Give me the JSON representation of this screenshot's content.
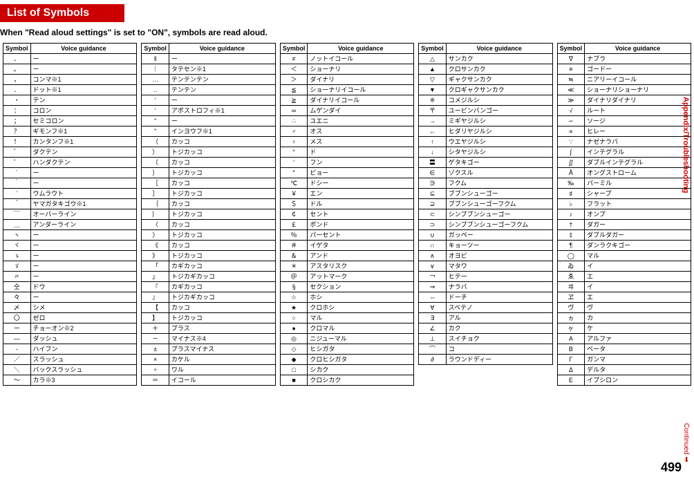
{
  "title": "List of Symbols",
  "subtitle": "When \"Read aloud settings\" is set to \"ON\", symbols are read aloud.",
  "side_label_appx": "Appendix/Troubleshooting",
  "continued": "Continued",
  "page_number": "499",
  "headers": {
    "symbol": "Symbol",
    "voice": "Voice guidance"
  },
  "columns": [
    [
      [
        "、",
        "ー"
      ],
      [
        "。",
        "ー"
      ],
      [
        "，",
        "コンマ※1"
      ],
      [
        "．",
        "ドット※1"
      ],
      [
        "・",
        "テン"
      ],
      [
        "：",
        "コロン"
      ],
      [
        "；",
        "セミコロン"
      ],
      [
        "？",
        "ギモンフ※1"
      ],
      [
        "！",
        "カンタンフ※1"
      ],
      [
        "゛",
        "ダクテン"
      ],
      [
        "゜",
        "ハンダクテン"
      ],
      [
        "´",
        "ー"
      ],
      [
        "｀",
        "ー"
      ],
      [
        "¨",
        "ウムラウト"
      ],
      [
        "＾",
        "ヤマガタキゴウ※1"
      ],
      [
        "￣",
        "オーバーライン"
      ],
      [
        "＿",
        "アンダーライン"
      ],
      [
        "ヽ",
        "ー"
      ],
      [
        "ヾ",
        "ー"
      ],
      [
        "ゝ",
        "ー"
      ],
      [
        "ゞ",
        "ー"
      ],
      [
        "〃",
        "ー"
      ],
      [
        "仝",
        "ドウ"
      ],
      [
        "々",
        "ー"
      ],
      [
        "〆",
        "シメ"
      ],
      [
        "〇",
        "ゼロ"
      ],
      [
        "ー",
        "チョーオン※2"
      ],
      [
        "―",
        "ダッシュ"
      ],
      [
        "‐",
        "ハイフン"
      ],
      [
        "／",
        "スラッシュ"
      ],
      [
        "＼",
        "バックスラッシュ"
      ],
      [
        "～",
        "カラ※3"
      ]
    ],
    [
      [
        "‖",
        "ー"
      ],
      [
        "｜",
        "タテセン※1"
      ],
      [
        "…",
        "テンテンテン"
      ],
      [
        "‥",
        "テンテン"
      ],
      [
        "'",
        "ー"
      ],
      [
        "'",
        "アポストロフィ※1"
      ],
      [
        "\"",
        "ー"
      ],
      [
        "\"",
        "インヨウフ※1"
      ],
      [
        "（",
        "カッコ"
      ],
      [
        "）",
        "トジカッコ"
      ],
      [
        "〔",
        "カッコ"
      ],
      [
        "〕",
        "トジカッコ"
      ],
      [
        "［",
        "カッコ"
      ],
      [
        "］",
        "トジカッコ"
      ],
      [
        "｛",
        "カッコ"
      ],
      [
        "｝",
        "トジカッコ"
      ],
      [
        "〈",
        "カッコ"
      ],
      [
        "〉",
        "トジカッコ"
      ],
      [
        "《",
        "カッコ"
      ],
      [
        "》",
        "トジカッコ"
      ],
      [
        "「",
        "カギカッコ"
      ],
      [
        "」",
        "トジカギカッコ"
      ],
      [
        "『",
        "カギカッコ"
      ],
      [
        "』",
        "トジカギカッコ"
      ],
      [
        "【",
        "カッコ"
      ],
      [
        "】",
        "トジカッコ"
      ],
      [
        "＋",
        "プラス"
      ],
      [
        "－",
        "マイナス※4"
      ],
      [
        "±",
        "プラスマイナス"
      ],
      [
        "×",
        "カケル"
      ],
      [
        "÷",
        "ワル"
      ],
      [
        "＝",
        "イコール"
      ]
    ],
    [
      [
        "≠",
        "ノットイコール"
      ],
      [
        "＜",
        "ショーナリ"
      ],
      [
        "＞",
        "ダイナリ"
      ],
      [
        "≦",
        "ショーナリイコール"
      ],
      [
        "≧",
        "ダイナリイコール"
      ],
      [
        "∞",
        "ムゲンダイ"
      ],
      [
        "∴",
        "ユエニ"
      ],
      [
        "♂",
        "オス"
      ],
      [
        "♀",
        "メス"
      ],
      [
        "°",
        "ド"
      ],
      [
        "′",
        "フン"
      ],
      [
        "″",
        "ビョー"
      ],
      [
        "℃",
        "ドシー"
      ],
      [
        "￥",
        "エン"
      ],
      [
        "＄",
        "ドル"
      ],
      [
        "￠",
        "セント"
      ],
      [
        "￡",
        "ポンド"
      ],
      [
        "％",
        "パーセント"
      ],
      [
        "＃",
        "イゲタ"
      ],
      [
        "＆",
        "アンド"
      ],
      [
        "＊",
        "アスタリスク"
      ],
      [
        "＠",
        "アットマーク"
      ],
      [
        "§",
        "セクション"
      ],
      [
        "☆",
        "ホシ"
      ],
      [
        "★",
        "クロホシ"
      ],
      [
        "○",
        "マル"
      ],
      [
        "●",
        "クロマル"
      ],
      [
        "◎",
        "ニジューマル"
      ],
      [
        "◇",
        "ヒシガタ"
      ],
      [
        "◆",
        "クロヒシガタ"
      ],
      [
        "□",
        "シカク"
      ],
      [
        "■",
        "クロシカク"
      ]
    ],
    [
      [
        "△",
        "サンカク"
      ],
      [
        "▲",
        "クロサンカク"
      ],
      [
        "▽",
        "ギャクサンカク"
      ],
      [
        "▼",
        "クロギャクサンカク"
      ],
      [
        "※",
        "コメジルシ"
      ],
      [
        "〒",
        "ユービンバンゴー"
      ],
      [
        "→",
        "ミギヤジルシ"
      ],
      [
        "←",
        "ヒダリヤジルシ"
      ],
      [
        "↑",
        "ウエヤジルシ"
      ],
      [
        "↓",
        "シタヤジルシ"
      ],
      [
        "〓",
        "ゲタキゴー"
      ],
      [
        "∈",
        "ゾクスル"
      ],
      [
        "∋",
        "フクム"
      ],
      [
        "⊆",
        "ブブンシューゴー"
      ],
      [
        "⊇",
        "ブブンシューゴーフクム"
      ],
      [
        "⊂",
        "シンブブンシューゴー"
      ],
      [
        "⊃",
        "シンブブンシューゴーフクム"
      ],
      [
        "∪",
        "ガッペー"
      ],
      [
        "∩",
        "キョーツー"
      ],
      [
        "∧",
        "オヨビ"
      ],
      [
        "∨",
        "マタワ"
      ],
      [
        "￢",
        "ヒテー"
      ],
      [
        "⇒",
        "ナラバ"
      ],
      [
        "⇔",
        "ドーチ"
      ],
      [
        "∀",
        "スベテノ"
      ],
      [
        "∃",
        "アル"
      ],
      [
        "∠",
        "カク"
      ],
      [
        "⊥",
        "スイチョク"
      ],
      [
        "⌒",
        "コ"
      ],
      [
        "∂",
        "ラウンドディー"
      ]
    ],
    [
      [
        "∇",
        "ナブラ"
      ],
      [
        "≡",
        "ゴードー"
      ],
      [
        "≒",
        "ニアリーイコール"
      ],
      [
        "≪",
        "ショーナリショーナリ"
      ],
      [
        "≫",
        "ダイナリダイナリ"
      ],
      [
        "√",
        "ルート"
      ],
      [
        "∽",
        "ソージ"
      ],
      [
        "∝",
        "ヒレー"
      ],
      [
        "∵",
        "ナゼナラバ"
      ],
      [
        "∫",
        "インテグラル"
      ],
      [
        "∬",
        "ダブルインテグラル"
      ],
      [
        "Å",
        "オングストローム"
      ],
      [
        "‰",
        "パーミル"
      ],
      [
        "♯",
        "シャープ"
      ],
      [
        "♭",
        "フラット"
      ],
      [
        "♪",
        "オンプ"
      ],
      [
        "†",
        "ダガー"
      ],
      [
        "‡",
        "ダブルダガー"
      ],
      [
        "¶",
        "ダンラクキゴー"
      ],
      [
        "◯",
        "マル"
      ],
      [
        "ゐ",
        "イ"
      ],
      [
        "ゑ",
        "エ"
      ],
      [
        "ヰ",
        "イ"
      ],
      [
        "ヱ",
        "エ"
      ],
      [
        "ヴ",
        "ヴ"
      ],
      [
        "ヵ",
        "カ"
      ],
      [
        "ヶ",
        "ケ"
      ],
      [
        "Α",
        "アルファ"
      ],
      [
        "Β",
        "ベータ"
      ],
      [
        "Γ",
        "ガンマ"
      ],
      [
        "Δ",
        "デルタ"
      ],
      [
        "Ε",
        "イプシロン"
      ]
    ]
  ]
}
